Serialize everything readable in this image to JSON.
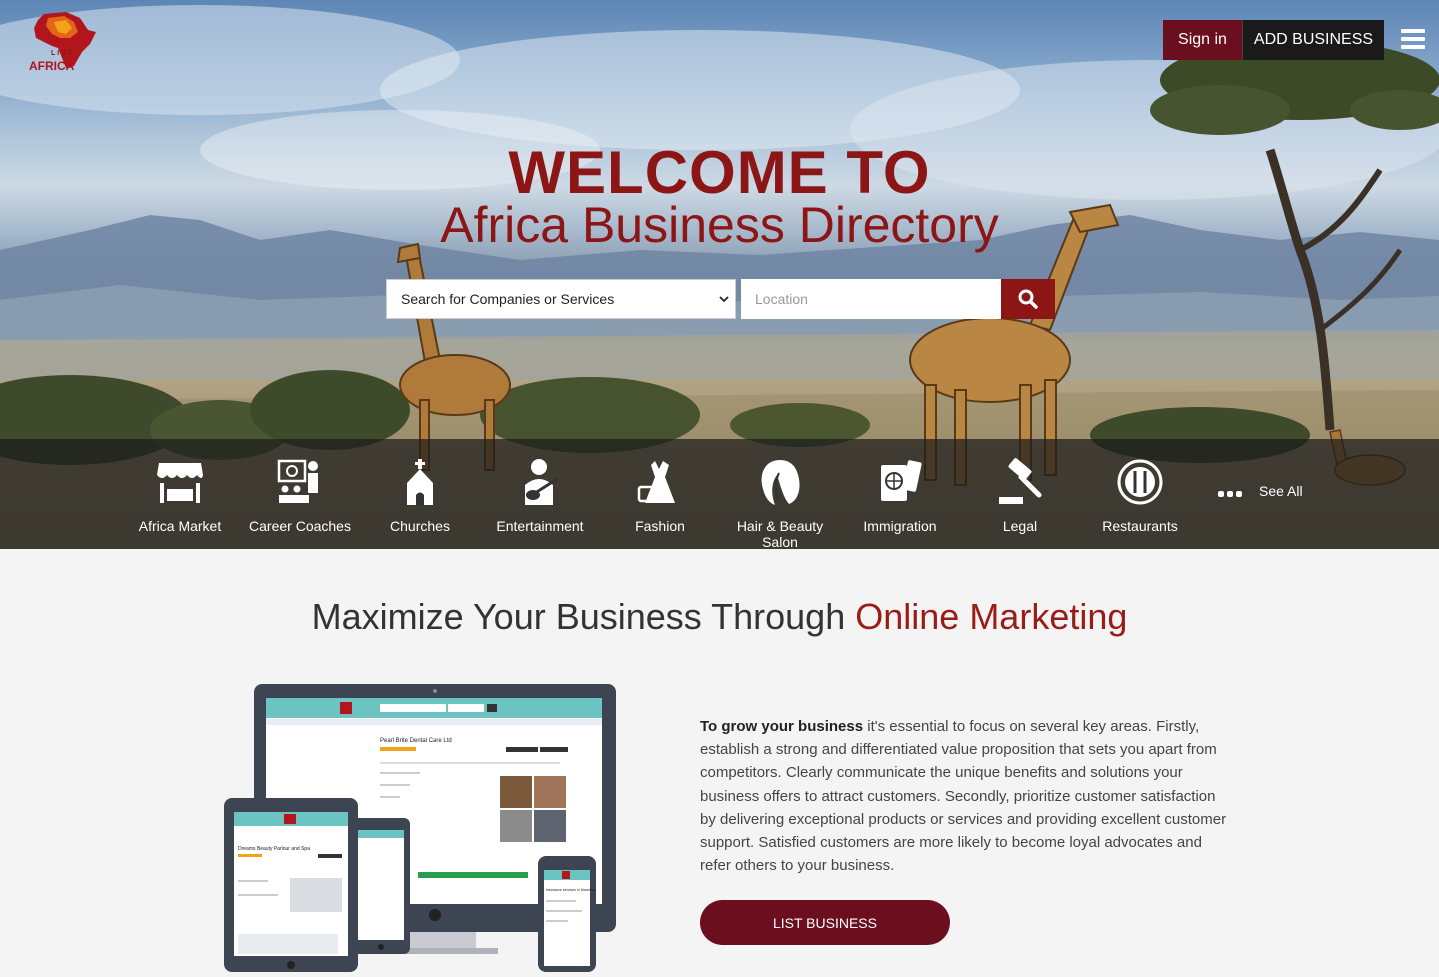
{
  "brand": {
    "logo_list": "LIST",
    "logo_africa": "AFRICA"
  },
  "header": {
    "signin_label": "Sign in",
    "add_business_label": "ADD BUSINESS"
  },
  "hero": {
    "welcome": "WELCOME TO",
    "subtitle": "Africa Business Directory"
  },
  "search": {
    "select_value": "Search for Companies or Services",
    "location_placeholder": "Location"
  },
  "categories": [
    {
      "label": "Africa Market",
      "icon": "market-stall-icon"
    },
    {
      "label": "Career Coaches",
      "icon": "presenter-icon"
    },
    {
      "label": "Churches",
      "icon": "church-icon"
    },
    {
      "label": "Entertainment",
      "icon": "guitarist-icon"
    },
    {
      "label": "Fashion",
      "icon": "dress-icon"
    },
    {
      "label": "Hair & Beauty Salon",
      "icon": "hair-icon"
    },
    {
      "label": "Immigration",
      "icon": "passport-icon"
    },
    {
      "label": "Legal",
      "icon": "gavel-icon"
    },
    {
      "label": "Restaurants",
      "icon": "plate-cutlery-icon"
    }
  ],
  "see_all_label": "See All",
  "marketing": {
    "title_plain": "Maximize Your Business Through",
    "title_accent": "Online Marketing",
    "para_bold": "To grow your business",
    "para_rest": " it's essential to focus on several key areas. Firstly, establish a strong and differentiated value proposition that sets you apart from competitors. Clearly communicate the unique benefits and solutions your business offers to attract customers. Secondly, prioritize customer satisfaction by delivering exceptional products or services and providing excellent customer support. Satisfied customers are more likely to become loyal advocates and refer others to your business.",
    "list_button": "LIST BUSINESS",
    "mock_desktop_title": "Pearl Brite Dental Care Ltd",
    "mock_tablet_title": "Dreams Beauty Parlour and Spa",
    "mock_phone_title": "Insurance services in Mauritius"
  },
  "colors": {
    "brand_red": "#8c1515",
    "button_maroon": "#6b0f1e",
    "bar_dark": "rgba(28,28,28,0.72)"
  }
}
